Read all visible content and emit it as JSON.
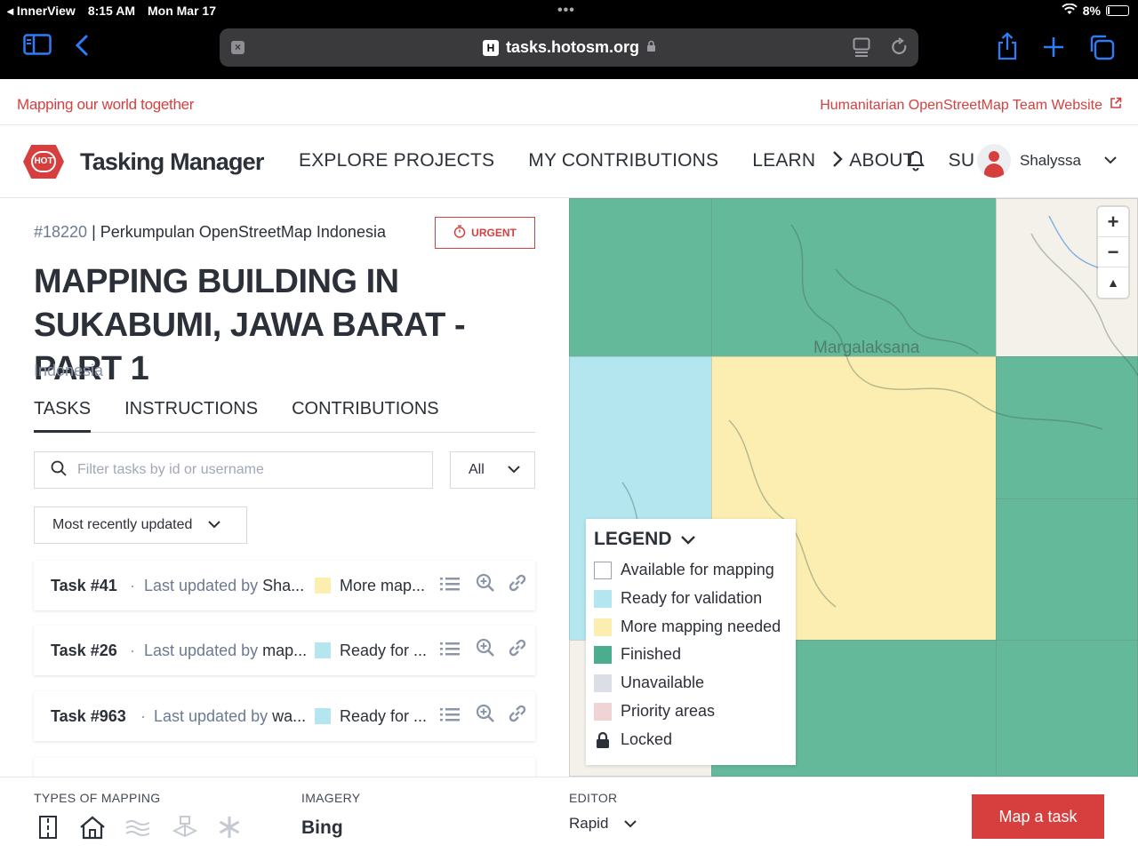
{
  "status_bar": {
    "app": "InnerView",
    "time": "8:15 AM",
    "date": "Mon Mar 17",
    "battery": "8%"
  },
  "browser": {
    "url": "tasks.hotosm.org",
    "site_letter": "H"
  },
  "top_strip": {
    "tagline": "Mapping our world together",
    "hot_link": "Humanitarian OpenStreetMap Team Website"
  },
  "nav": {
    "logo_badge": "HOT",
    "logo_text": "Tasking Manager",
    "links": [
      "EXPLORE PROJECTS",
      "MY CONTRIBUTIONS",
      "LEARN",
      "ABOUT",
      "SU"
    ],
    "user": "Shalyssa"
  },
  "project": {
    "id": "#18220",
    "org": "| Perkumpulan OpenStreetMap Indonesia",
    "urgent": "URGENT",
    "title": "MAPPING BUILDING IN SUKABUMI, JAWA BARAT - PART 1",
    "country": "Indonesia"
  },
  "tabs": [
    "TASKS",
    "INSTRUCTIONS",
    "CONTRIBUTIONS"
  ],
  "filter": {
    "placeholder": "Filter tasks by id or username",
    "status_select": "All",
    "sort_select": "Most recently updated"
  },
  "tasks": [
    {
      "id": "Task #41",
      "updated_prefix": "Last updated by ",
      "updated_user": "Sha...",
      "status": "More map...",
      "color": "#fbeeb0"
    },
    {
      "id": "Task #26",
      "updated_prefix": "Last updated by ",
      "updated_user": "map...",
      "status": "Ready for ...",
      "color": "#b3e6ee"
    },
    {
      "id": "Task #963",
      "updated_prefix": "Last updated by ",
      "updated_user": "wa...",
      "status": "Ready for ...",
      "color": "#b3e6ee"
    }
  ],
  "map": {
    "place_label": "Margalaksana"
  },
  "legend": {
    "title": "LEGEND",
    "items": [
      {
        "label": "Available for mapping",
        "color": "#ffffff"
      },
      {
        "label": "Ready for validation",
        "color": "#b3e6ee"
      },
      {
        "label": "More mapping needed",
        "color": "#fbeeb0"
      },
      {
        "label": "Finished",
        "color": "#4aad8e"
      },
      {
        "label": "Unavailable",
        "color": "#dcdee6"
      },
      {
        "label": "Priority areas",
        "color": "#f0d3d4"
      },
      {
        "label": "Locked",
        "color": "lock"
      }
    ]
  },
  "bottom": {
    "types_label": "TYPES OF MAPPING",
    "imagery_label": "IMAGERY",
    "imagery_value": "Bing",
    "editor_label": "EDITOR",
    "editor_value": "Rapid",
    "map_button": "Map a task"
  },
  "colors": {
    "accent": "#d73f3f",
    "finished": "#64b99b",
    "ready": "#b3e6ee",
    "more": "#fbeeb0"
  }
}
